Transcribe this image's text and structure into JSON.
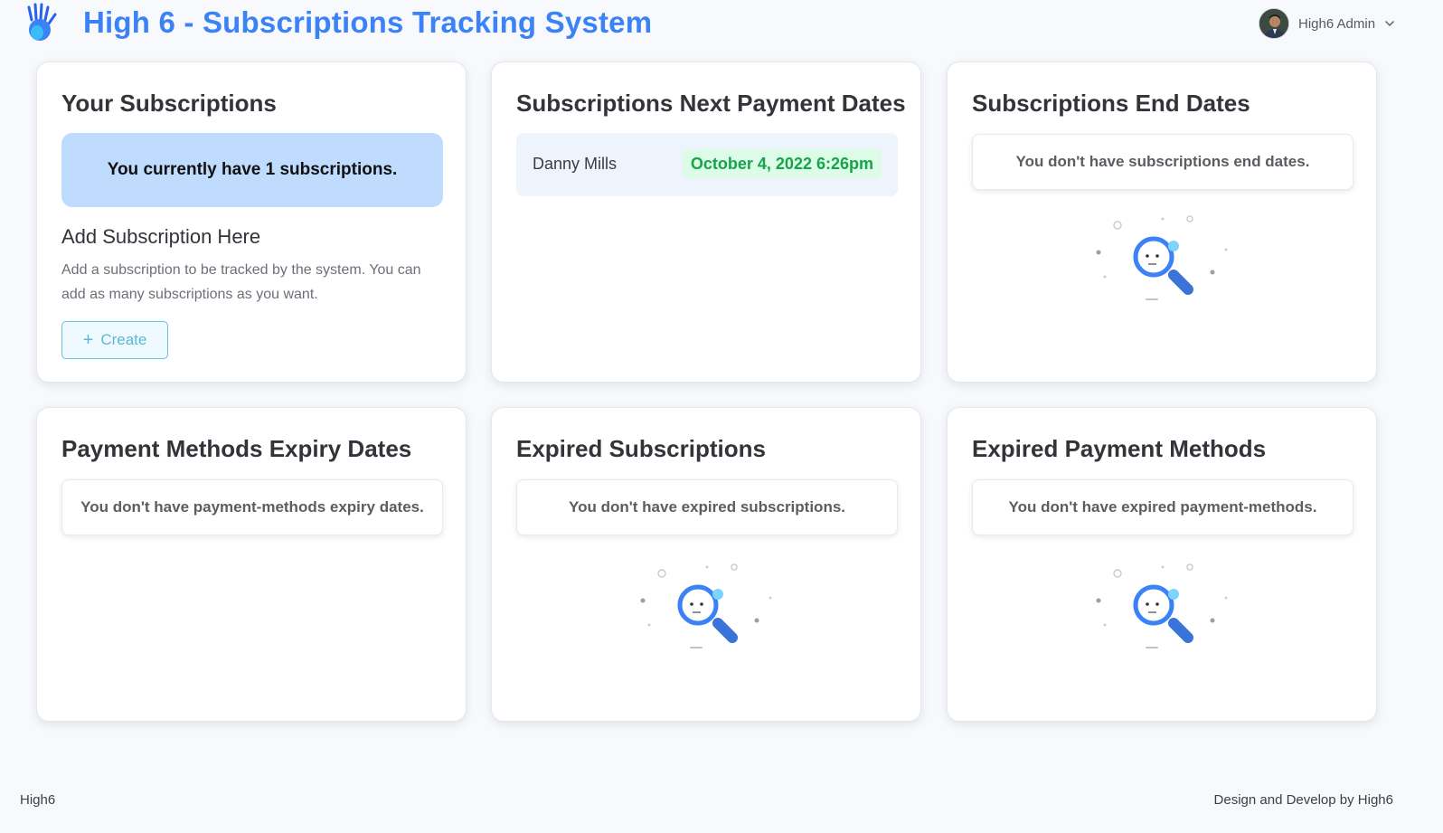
{
  "app": {
    "title": "High 6 - Subscriptions Tracking System",
    "logo_icon": "hand-icon",
    "accent_color": "#3b82f6"
  },
  "user": {
    "name": "High6 Admin",
    "menu_icon": "chevron-down-icon"
  },
  "cards": {
    "your_subscriptions": {
      "title": "Your Subscriptions",
      "count_message": "You currently have 1 subscriptions.",
      "add_heading": "Add Subscription Here",
      "add_description": "Add a subscription to be tracked by the system. You can add as many subscriptions as you want.",
      "create_label": "Create"
    },
    "next_payment_dates": {
      "title": "Subscriptions Next Payment Dates",
      "rows": [
        {
          "name": "Danny Mills",
          "date": "October 4, 2022 6:26pm"
        }
      ],
      "date_badge_color": "#16a34a"
    },
    "end_dates": {
      "title": "Subscriptions End Dates",
      "empty_message": "You don't have subscriptions end dates."
    },
    "payment_methods_expiry": {
      "title": "Payment Methods Expiry Dates",
      "empty_message": "You don't have payment-methods expiry dates."
    },
    "expired_subscriptions": {
      "title": "Expired Subscriptions",
      "empty_message": "You don't have expired subscriptions."
    },
    "expired_payment_methods": {
      "title": "Expired Payment Methods",
      "empty_message": "You don't have expired payment-methods."
    }
  },
  "footer": {
    "left": "High6",
    "right": "Design and Develop by High6"
  }
}
